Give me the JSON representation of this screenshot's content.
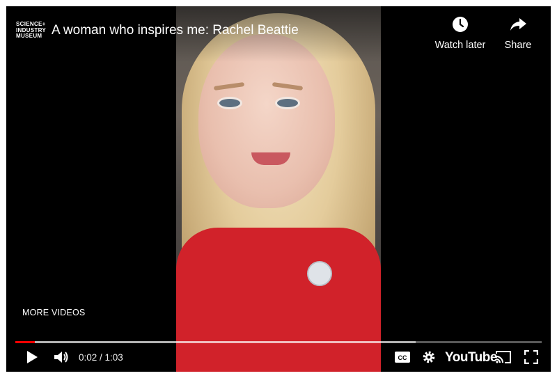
{
  "channel": {
    "logo_line1": "SCIENCE+",
    "logo_line2": "INDUSTRY",
    "logo_line3": "MUSEUM"
  },
  "video": {
    "title": "A woman who inspires me: Rachel Beattie"
  },
  "top_actions": {
    "watch_later": "Watch later",
    "share": "Share"
  },
  "more_videos": "MORE VIDEOS",
  "playback": {
    "current_time": "0:02",
    "duration": "1:03",
    "time_display": "0:02 / 1:03",
    "played_fraction": 0.037,
    "loaded_fraction": 0.76
  },
  "branding": {
    "youtube": "YouTube"
  },
  "icons": [
    "clock-icon",
    "share-arrow-icon",
    "play-icon",
    "volume-icon",
    "captions-icon",
    "gear-icon",
    "cast-icon",
    "fullscreen-icon"
  ],
  "colors": {
    "progress_played": "#ff0000",
    "shirt": "#d1222a",
    "player_bg": "#000000"
  }
}
